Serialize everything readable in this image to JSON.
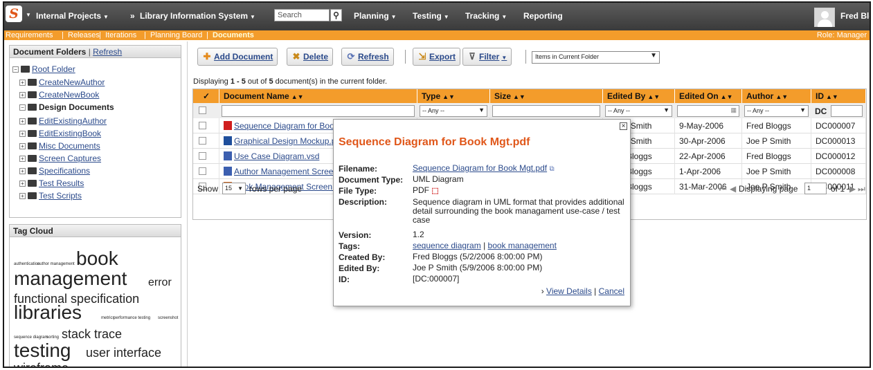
{
  "topnav": {
    "product_title": "Internal Projects",
    "breadcrumb_sep": "»",
    "project_title": "Library Information System",
    "search_placeholder": "Search",
    "menus": [
      "Planning",
      "Testing",
      "Tracking",
      "Reporting"
    ],
    "user_name": "Fred Bloggs"
  },
  "subnav": {
    "items": [
      "Requirements",
      "Releases",
      "Iterations",
      "Planning Board",
      "Documents"
    ],
    "separator": "|",
    "role": "Role: Manager"
  },
  "folders": {
    "title": "Document Folders",
    "refresh": "Refresh",
    "root": "Root Folder",
    "items": [
      "CreateNewAuthor",
      "CreateNewBook",
      "Design Documents",
      "EditExistingAuthor",
      "EditExistingBook",
      "Misc Documents",
      "Screen Captures",
      "Specifications",
      "Test Results",
      "Test Scripts"
    ]
  },
  "tagcloud": {
    "title": "Tag Cloud",
    "tags": [
      "authentication",
      "author management",
      "book",
      "management",
      "error",
      "functional specification",
      "libraries",
      "metrics",
      "performance testing",
      "screenshot",
      "sequence diagram",
      "sorting",
      "stack trace",
      "testing",
      "user interface",
      "wireframe"
    ]
  },
  "toolbar": {
    "add_document": "Add Document",
    "delete": "Delete",
    "refresh": "Refresh",
    "export": "Export",
    "filter": "Filter",
    "view_select": "Items in Current Folder"
  },
  "displaying": {
    "prefix": "Displaying ",
    "range": "1 - 5",
    "middle": " out of ",
    "total": "5",
    "suffix": " document(s) in the current folder."
  },
  "grid": {
    "check_header": "✓",
    "sort_arrows": "▲▼",
    "columns": [
      "Document Name",
      "Type",
      "Size",
      "Edited By",
      "Edited On",
      "Author",
      "ID"
    ],
    "filter_any": "-- Any --",
    "id_prefix": "DC",
    "rows": [
      {
        "name": "Sequence Diagram for Book Mgt.pdf",
        "icon": "pdf-icon",
        "edited_by": "Joe P Smith",
        "edited_on": "9-May-2006",
        "author": "Fred Bloggs",
        "id": "DC000007"
      },
      {
        "name": "Graphical Design Mockup.psd",
        "icon": "image-icon",
        "edited_by": "Joe P Smith",
        "edited_on": "30-Apr-2006",
        "author": "Joe P Smith",
        "id": "DC000013"
      },
      {
        "name": "Use Case Diagram.vsd",
        "icon": "visio-icon",
        "edited_by": "Fred Bloggs",
        "edited_on": "22-Apr-2006",
        "author": "Fred Bloggs",
        "id": "DC000012"
      },
      {
        "name": "Author Management Screen.vsd",
        "icon": "visio-icon",
        "edited_by": "Fred Bloggs",
        "edited_on": "1-Apr-2006",
        "author": "Joe P Smith",
        "id": "DC000008"
      },
      {
        "name": "Book Management Screen.ppt",
        "icon": "ppt-icon",
        "edited_by": "Fred Bloggs",
        "edited_on": "31-Mar-2006",
        "author": "Joe P Smith",
        "id": "DC000011"
      }
    ],
    "footer": {
      "show": "Show",
      "page_size": "15",
      "rows_per_page": "rows per page",
      "displaying_page": "Displaying page",
      "page": "1",
      "of": "of 1"
    }
  },
  "popup": {
    "title": "Sequence Diagram for Book Mgt.pdf",
    "close": "×",
    "filename_label": "Filename:",
    "filename": "Sequence Diagram for Book Mgt.pdf",
    "doctype_label": "Document Type:",
    "doctype": "UML Diagram",
    "filetype_label": "File Type:",
    "filetype": "PDF",
    "description_label": "Description:",
    "description": "Sequence diagram in UML format that provides additional detail surrounding the book managament use-case / test case",
    "version_label": "Version:",
    "version": "1.2",
    "tags_label": "Tags:",
    "tags": [
      "sequence diagram",
      "book management"
    ],
    "created_by_label": "Created By:",
    "created_by": "Fred Bloggs (5/2/2006 8:00:00 PM)",
    "edited_by_label": "Edited By:",
    "edited_by": "Joe P Smith (5/9/2006 8:00:00 PM)",
    "id_label": "ID:",
    "id": "[DC:000007]",
    "view_details": "View Details",
    "cancel": "Cancel"
  },
  "colors": {
    "topbar": "#474747",
    "accent_orange": "#f39c2b",
    "popup_title": "#e0571a",
    "link": "#2b4a8b"
  }
}
